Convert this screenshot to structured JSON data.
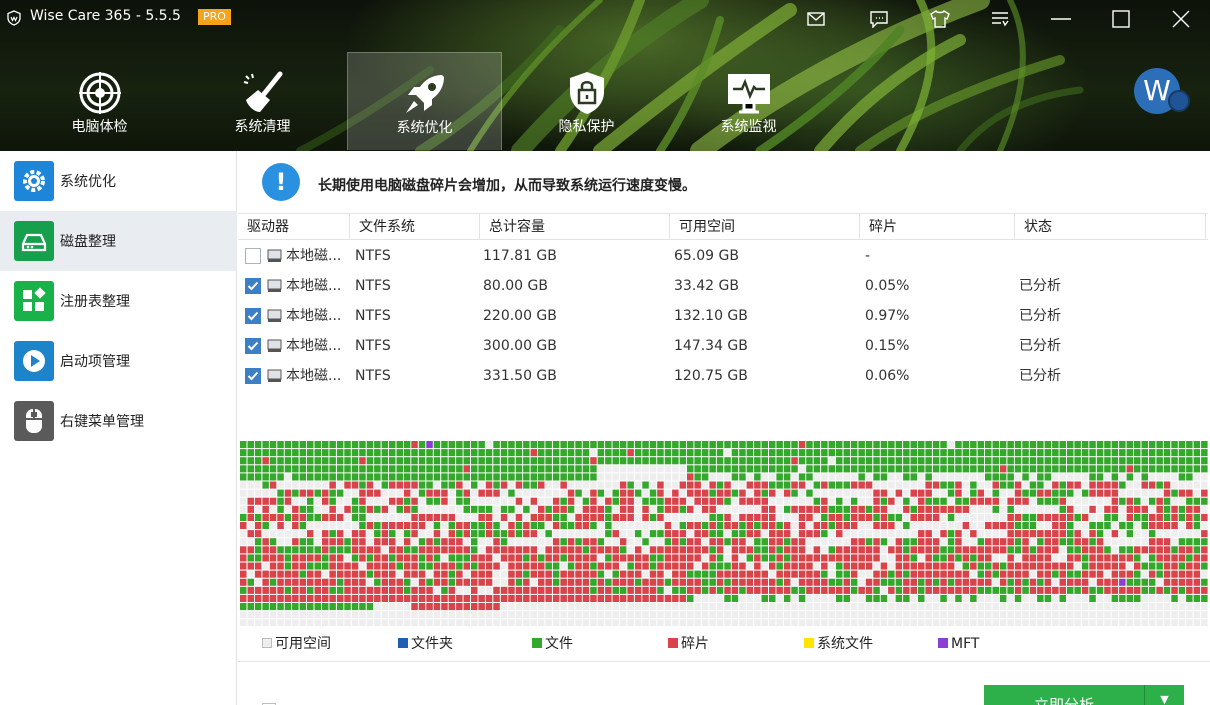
{
  "app": {
    "title": "Wise Care 365 - 5.5.5",
    "badge": "PRO"
  },
  "titlebar_buttons": [
    "mail-icon",
    "feedback-icon",
    "skin-icon",
    "menu-icon",
    "minimize-icon",
    "maximize-icon",
    "close-icon"
  ],
  "nav": {
    "tabs": [
      {
        "label": "电脑体检",
        "icon": "radar-icon",
        "active": false
      },
      {
        "label": "系统清理",
        "icon": "broom-icon",
        "active": false
      },
      {
        "label": "系统优化",
        "icon": "rocket-icon",
        "active": true
      },
      {
        "label": "隐私保护",
        "icon": "lock-shield-icon",
        "active": false
      },
      {
        "label": "系统监视",
        "icon": "monitor-pulse-icon",
        "active": false
      }
    ],
    "avatar_letter": "W"
  },
  "sidebar": {
    "items": [
      {
        "label": "系统优化",
        "icon": "gear-icon",
        "color": "#1e86d8",
        "active": false
      },
      {
        "label": "磁盘整理",
        "icon": "disk-icon",
        "color": "#16a04e",
        "active": true
      },
      {
        "label": "注册表整理",
        "icon": "registry-blocks-icon",
        "color": "#18b14a",
        "active": false
      },
      {
        "label": "启动项管理",
        "icon": "startup-play-icon",
        "color": "#1d84c9",
        "active": false
      },
      {
        "label": "右键菜单管理",
        "icon": "mouse-icon",
        "color": "#5a5a5a",
        "active": false
      }
    ]
  },
  "main": {
    "info": "长期使用电脑磁盘碎片会增加，从而导致系统运行速度变慢。",
    "columns": [
      "驱动器",
      "文件系统",
      "总计容量",
      "可用空间",
      "碎片",
      "状态"
    ],
    "rows": [
      {
        "checked": false,
        "drive": "本地磁...",
        "fs": "NTFS",
        "total": "117.81 GB",
        "free": "65.09 GB",
        "frag": "-",
        "status": ""
      },
      {
        "checked": true,
        "drive": "本地磁...",
        "fs": "NTFS",
        "total": "80.00 GB",
        "free": "33.42 GB",
        "frag": "0.05%",
        "status": "已分析"
      },
      {
        "checked": true,
        "drive": "本地磁...",
        "fs": "NTFS",
        "total": "220.00 GB",
        "free": "132.10 GB",
        "frag": "0.97%",
        "status": "已分析"
      },
      {
        "checked": true,
        "drive": "本地磁...",
        "fs": "NTFS",
        "total": "300.00 GB",
        "free": "147.34 GB",
        "frag": "0.15%",
        "status": "已分析"
      },
      {
        "checked": true,
        "drive": "本地磁...",
        "fs": "NTFS",
        "total": "331.50 GB",
        "free": "120.75 GB",
        "frag": "0.06%",
        "status": "已分析"
      }
    ],
    "legend": [
      {
        "label": "可用空间",
        "color": "#eeeeee"
      },
      {
        "label": "文件夹",
        "color": "#1d5fb0"
      },
      {
        "label": "文件",
        "color": "#34a82a"
      },
      {
        "label": "碎片",
        "color": "#d9434a"
      },
      {
        "label": "系统文件",
        "color": "#ffe400"
      },
      {
        "label": "MFT",
        "color": "#8b3fd2"
      }
    ],
    "analyze_button": "立即分析"
  }
}
